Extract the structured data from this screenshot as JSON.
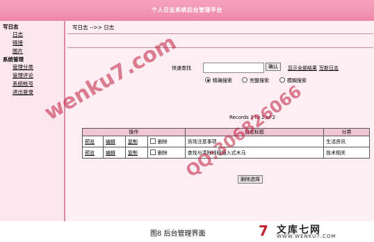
{
  "header": {
    "title": "个人日志系统后台管理平台"
  },
  "sidebar": {
    "section1": "写日志",
    "items1": [
      "日志",
      "链接",
      "图片"
    ],
    "section2": "系统管理",
    "items2": [
      "管理分类",
      "管理评论",
      "系统帐号",
      "退出登录"
    ]
  },
  "main": {
    "breadcrumb": "写日志 -->> 日志",
    "search_label": "快速查找",
    "search_value": "",
    "confirm_button": "确认",
    "show_all_link": "显示全部结果",
    "new_log_link": "写新日志",
    "radios": [
      {
        "label": "精确搜索",
        "checked": true
      },
      {
        "label": "完整搜索",
        "checked": false
      },
      {
        "label": "模糊搜索",
        "checked": false
      }
    ],
    "record_count": "Records 1 to 2 of 2",
    "table": {
      "headers": [
        "操作",
        "日志标题",
        "分类"
      ],
      "rows": [
        {
          "actions": [
            "预览",
            "编辑",
            "复制",
            "删除"
          ],
          "title": "货场注意事项",
          "category": "生活资讯"
        },
        {
          "actions": [
            "预览",
            "编辑",
            "复制",
            "删除"
          ],
          "title": "查找与清除线程插入式木马",
          "category": "技术相关"
        }
      ]
    },
    "delete_selected_button": "删除选择"
  },
  "caption": "图8 后台管理界面",
  "watermark": {
    "site": "wenku7.com",
    "qq": "QQ:306826066"
  },
  "logo": {
    "mark": "7",
    "name": "文库七网",
    "url": "WWW.WENKU7.COM"
  },
  "colors": {
    "header": "#ee87ab",
    "background": "#fbe3ec",
    "watermark": "#c01e3c"
  }
}
